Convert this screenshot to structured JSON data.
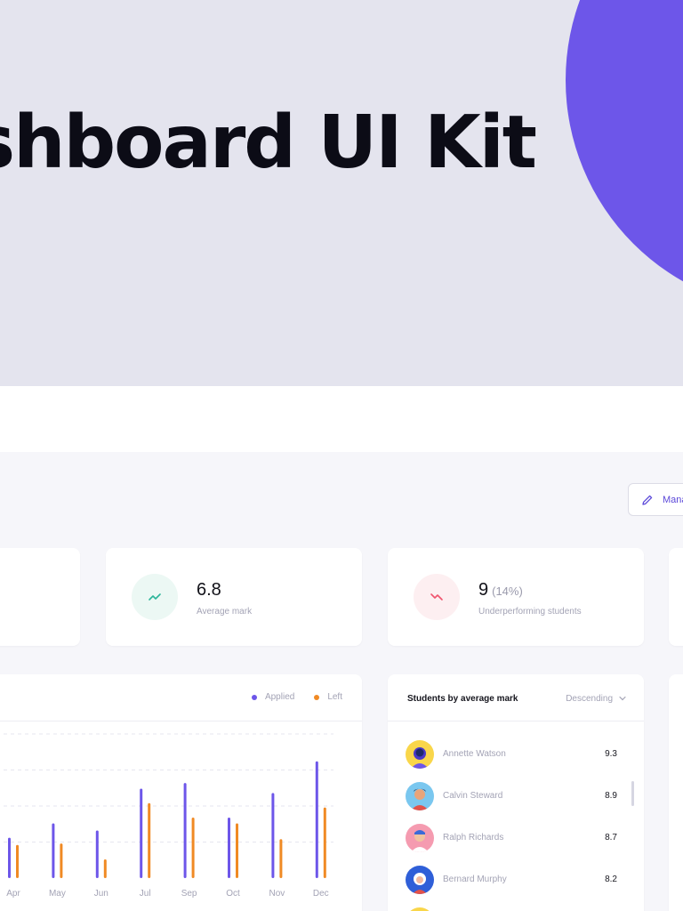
{
  "hero": {
    "title": "ashboard UI Kit",
    "accent_color": "#6d56e9",
    "background_color": "#e4e4ee"
  },
  "toolbar": {
    "manage_label": "Manage",
    "manage_icon": "pencil-icon"
  },
  "stats": [
    {
      "value": "6.8",
      "sub": "",
      "label": "Average mark",
      "icon": "trend-up-icon",
      "tone": "#2bb59a"
    },
    {
      "value": "9",
      "sub": "(14%)",
      "label": "Underperforming students",
      "icon": "trend-down-icon",
      "tone": "#f0536d"
    }
  ],
  "chart": {
    "legend": [
      {
        "name": "Applied",
        "color": "#6d56e9"
      },
      {
        "name": "Left",
        "color": "#f08a24"
      }
    ]
  },
  "chart_data": {
    "type": "bar",
    "categories": [
      "Apr",
      "May",
      "Jun",
      "Jul",
      "Sep",
      "Oct",
      "Nov",
      "Dec"
    ],
    "series": [
      {
        "name": "Applied",
        "values": [
          28,
          38,
          33,
          62,
          66,
          42,
          59,
          81
        ]
      },
      {
        "name": "Left",
        "values": [
          23,
          24,
          13,
          52,
          42,
          38,
          27,
          49
        ]
      }
    ],
    "ylim": [
      0,
      100
    ],
    "grid": true,
    "legend_position": "top-right"
  },
  "students": {
    "title": "Students by average mark",
    "sort_label": "Descending",
    "sort_icon": "chevron-down-icon",
    "rows": [
      {
        "name": "Annette Watson",
        "score": "9.3",
        "avatar_bg": "#f9d64a"
      },
      {
        "name": "Calvin Steward",
        "score": "8.9",
        "avatar_bg": "#7ac7ef"
      },
      {
        "name": "Ralph Richards",
        "score": "8.7",
        "avatar_bg": "#f59bb0"
      },
      {
        "name": "Bernard Murphy",
        "score": "8.2",
        "avatar_bg": "#2f5fd8"
      }
    ]
  }
}
